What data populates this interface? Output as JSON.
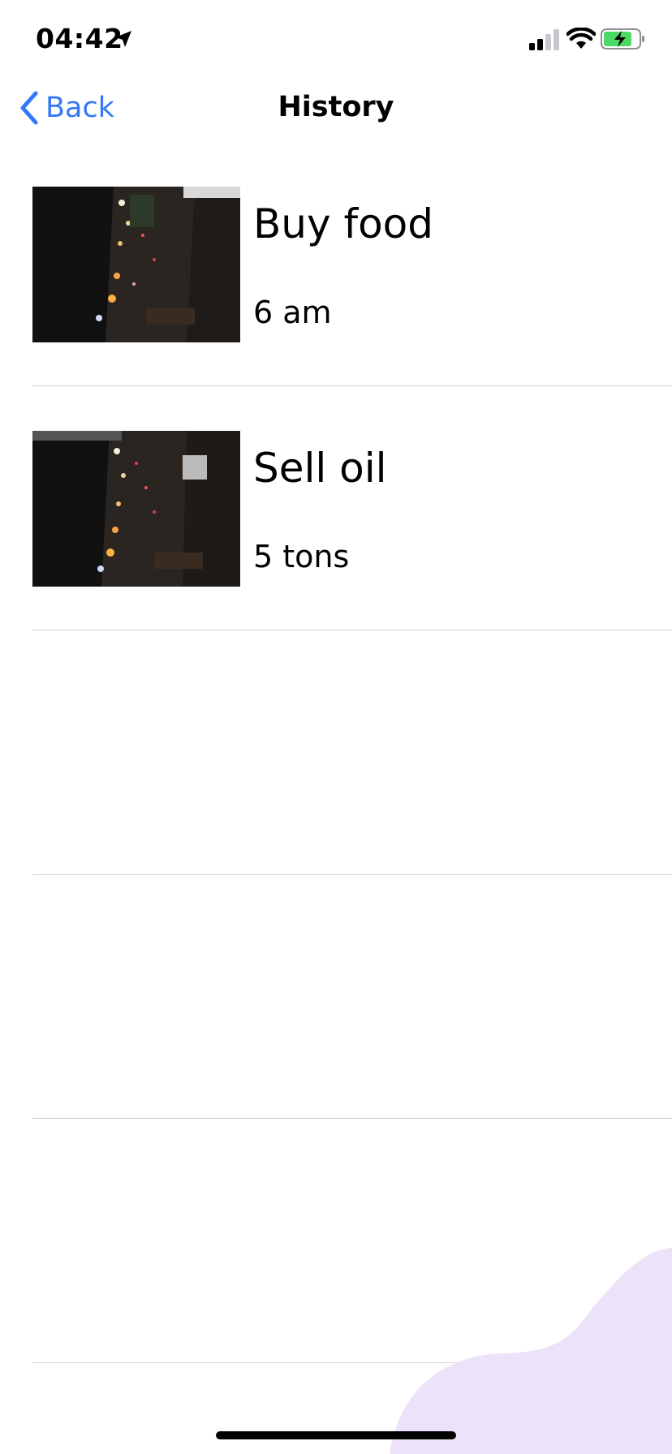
{
  "status_bar": {
    "time": "04:42",
    "icons": [
      "location-arrow-icon",
      "cellular-signal-icon",
      "wifi-icon",
      "battery-charging-icon"
    ]
  },
  "nav": {
    "back_label": "Back",
    "title": "History"
  },
  "colors": {
    "accent": "#3478f6",
    "separator": "#d3d3d6",
    "battery_fill": "#4cd964",
    "blob": "#ece3fa"
  },
  "history": [
    {
      "title": "Buy food",
      "subtitle": "6 am",
      "image_icon": "night-market-photo"
    },
    {
      "title": "Sell oil",
      "subtitle": "5 tons",
      "image_icon": "night-market-photo"
    }
  ]
}
